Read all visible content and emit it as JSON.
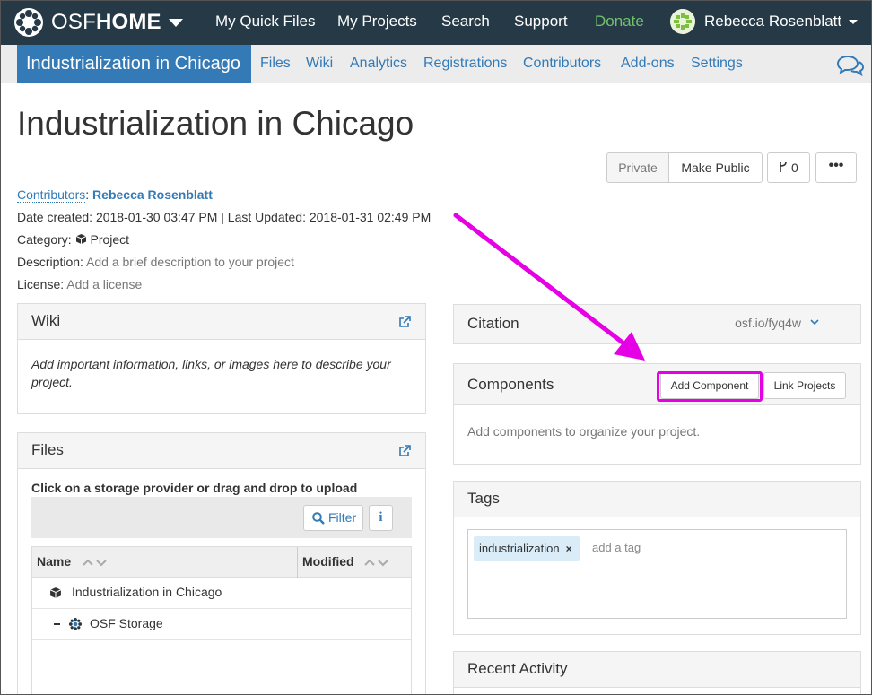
{
  "topnav": {
    "brand_light": "OSF",
    "brand_bold": "HOME",
    "links": [
      "My Quick Files",
      "My Projects",
      "Search",
      "Support",
      "Donate"
    ],
    "user_name": "Rebecca Rosenblatt"
  },
  "projnav": {
    "project_title": "Industrialization in Chicago",
    "links": [
      "Files",
      "Wiki",
      "Analytics",
      "Registrations",
      "Contributors",
      "Add-ons",
      "Settings"
    ]
  },
  "header": {
    "title": "Industrialization in Chicago",
    "private_label": "Private",
    "make_public_label": "Make Public",
    "fork_count": "0",
    "more_label": "•••"
  },
  "meta": {
    "contributors_label": "Contributors",
    "contributor_name": "Rebecca Rosenblatt",
    "date_line": "Date created: 2018-01-30 03:47 PM | Last Updated: 2018-01-31 02:49 PM",
    "category_label": "Category:",
    "category_value": "Project",
    "description_label": "Description:",
    "description_placeholder": "Add a brief description to your project",
    "license_label": "License:",
    "license_placeholder": "Add a license"
  },
  "wiki": {
    "title": "Wiki",
    "body": "Add important information, links, or images here to describe your project."
  },
  "files": {
    "title": "Files",
    "hint": "Click on a storage provider or drag and drop to upload",
    "filter_label": "Filter",
    "info_label": "i",
    "columns": [
      "Name",
      "Modified"
    ],
    "rows": [
      {
        "name": "Industrialization in Chicago"
      },
      {
        "name": "OSF Storage"
      }
    ]
  },
  "citation": {
    "title": "Citation",
    "url": "osf.io/fyq4w"
  },
  "components": {
    "title": "Components",
    "add_label": "Add Component",
    "link_label": "Link Projects",
    "body": "Add components to organize your project."
  },
  "tags": {
    "title": "Tags",
    "items": [
      "industrialization"
    ],
    "remove_glyph": "×",
    "placeholder": "add a tag"
  },
  "activity": {
    "title": "Recent Activity"
  },
  "colors": {
    "navbar": "#263947",
    "accent": "#337ab7",
    "donate": "#73c16c",
    "annotation": "#e600e6"
  }
}
